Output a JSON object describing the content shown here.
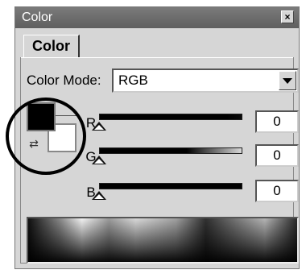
{
  "window": {
    "title": "Color",
    "close_glyph": "×"
  },
  "tabs": [
    {
      "label": "Color",
      "active": true
    }
  ],
  "color_mode": {
    "label": "Color Mode:",
    "selected": "RGB"
  },
  "swatches": {
    "foreground": "#000000",
    "background": "#ffffff",
    "swap_icon": "swap-arrows-icon"
  },
  "channels": [
    {
      "label": "R",
      "value": "0",
      "slider_fraction": 0,
      "gradient_to": "#ff0000"
    },
    {
      "label": "G",
      "value": "0",
      "slider_fraction": 0,
      "gradient_to": "#00ff00"
    },
    {
      "label": "B",
      "value": "0",
      "slider_fraction": 0,
      "gradient_to": "#0000ff"
    }
  ]
}
